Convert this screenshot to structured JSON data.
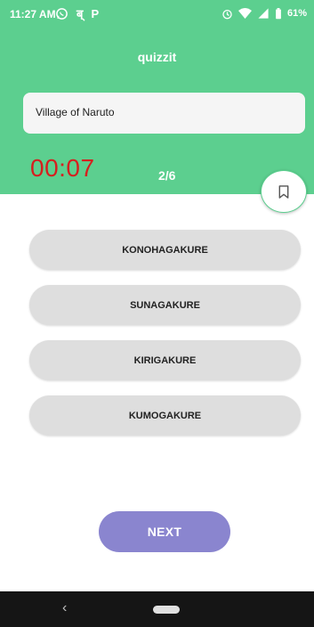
{
  "status_bar": {
    "time": "11:27 AM",
    "battery": "61%",
    "left_icons": [
      "whatsapp-icon",
      "hindi-char-icon",
      "p-icon"
    ],
    "right_icons": [
      "alarm-icon",
      "wifi-icon",
      "signal-icon",
      "battery-icon"
    ]
  },
  "app": {
    "title": "quizzit"
  },
  "question": {
    "text": "Village of Naruto"
  },
  "timer": {
    "value": "00:07"
  },
  "progress": {
    "text": "2/6"
  },
  "bookmark": {
    "icon": "bookmark-icon"
  },
  "options": [
    {
      "label": "KONOHAGAKURE"
    },
    {
      "label": "SUNAGAKURE"
    },
    {
      "label": "KIRIGAKURE"
    },
    {
      "label": "KUMOGAKURE"
    }
  ],
  "next_button": {
    "label": "NEXT"
  },
  "navigation": {
    "back_glyph": "‹"
  },
  "colors": {
    "header": "#5ccf8f",
    "timer": "#d61f1f",
    "next_button": "#8a85cf",
    "option_bg": "#dedede"
  }
}
